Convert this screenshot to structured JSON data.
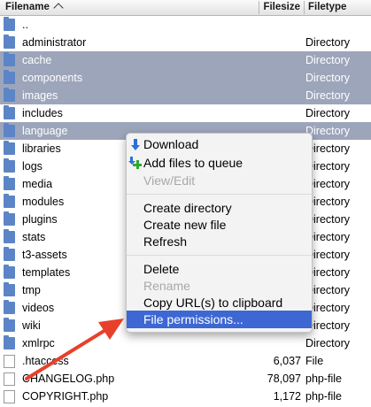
{
  "header": {
    "filename": "Filename",
    "filesize": "Filesize",
    "filetype": "Filetype"
  },
  "rows": [
    {
      "name": "..",
      "size": "",
      "type": "",
      "kind": "folder",
      "selected": false
    },
    {
      "name": "administrator",
      "size": "",
      "type": "Directory",
      "kind": "folder",
      "selected": false
    },
    {
      "name": "cache",
      "size": "",
      "type": "Directory",
      "kind": "folder",
      "selected": true
    },
    {
      "name": "components",
      "size": "",
      "type": "Directory",
      "kind": "folder",
      "selected": true
    },
    {
      "name": "images",
      "size": "",
      "type": "Directory",
      "kind": "folder",
      "selected": true
    },
    {
      "name": "includes",
      "size": "",
      "type": "Directory",
      "kind": "folder",
      "selected": false
    },
    {
      "name": "language",
      "size": "",
      "type": "Directory",
      "kind": "folder",
      "selected": true
    },
    {
      "name": "libraries",
      "size": "",
      "type": "Directory",
      "kind": "folder",
      "selected": false
    },
    {
      "name": "logs",
      "size": "",
      "type": "Directory",
      "kind": "folder",
      "selected": false
    },
    {
      "name": "media",
      "size": "",
      "type": "Directory",
      "kind": "folder",
      "selected": false
    },
    {
      "name": "modules",
      "size": "",
      "type": "Directory",
      "kind": "folder",
      "selected": false
    },
    {
      "name": "plugins",
      "size": "",
      "type": "Directory",
      "kind": "folder",
      "selected": false
    },
    {
      "name": "stats",
      "size": "",
      "type": "Directory",
      "kind": "folder",
      "selected": false
    },
    {
      "name": "t3-assets",
      "size": "",
      "type": "Directory",
      "kind": "folder",
      "selected": false
    },
    {
      "name": "templates",
      "size": "",
      "type": "Directory",
      "kind": "folder",
      "selected": false
    },
    {
      "name": "tmp",
      "size": "",
      "type": "Directory",
      "kind": "folder",
      "selected": false
    },
    {
      "name": "videos",
      "size": "",
      "type": "Directory",
      "kind": "folder",
      "selected": false
    },
    {
      "name": "wiki",
      "size": "",
      "type": "Directory",
      "kind": "folder",
      "selected": false
    },
    {
      "name": "xmlrpc",
      "size": "",
      "type": "Directory",
      "kind": "folder",
      "selected": false
    },
    {
      "name": ".htaccess",
      "size": "6,037",
      "type": "File",
      "kind": "file",
      "selected": false
    },
    {
      "name": "CHANGELOG.php",
      "size": "78,097",
      "type": "php-file",
      "kind": "file",
      "selected": false
    },
    {
      "name": "COPYRIGHT.php",
      "size": "1,172",
      "type": "php-file",
      "kind": "file",
      "selected": false
    }
  ],
  "context_menu": {
    "download": "Download",
    "add_to_queue": "Add files to queue",
    "view_edit": "View/Edit",
    "create_directory": "Create directory",
    "create_file": "Create new file",
    "refresh": "Refresh",
    "delete": "Delete",
    "rename": "Rename",
    "copy_url": "Copy URL(s) to clipboard",
    "file_permissions": "File permissions..."
  },
  "colors": {
    "selection": "#9da5bb",
    "menu_highlight": "#3d68d3",
    "folder_icon": "#5c85c7",
    "annotation_arrow": "#e8402a"
  }
}
